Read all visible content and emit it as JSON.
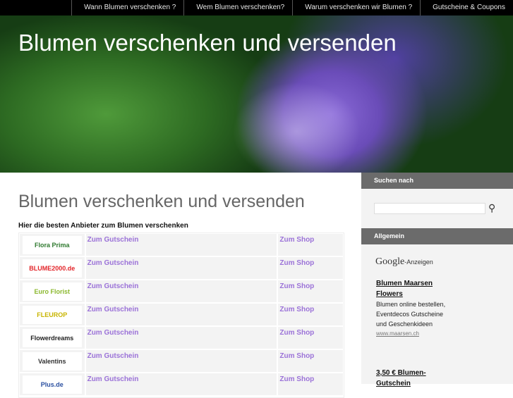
{
  "nav": [
    "Wann Blumen verschenken ?",
    "Wem Blumen verschenken?",
    "Warum verschenken wir Blumen ?",
    "Gutscheine & Coupons"
  ],
  "header": {
    "title": "Blumen verschenken und versenden"
  },
  "main": {
    "title": "Blumen verschenken und versenden",
    "subtitle": "Hier die besten Anbieter zum Blumen verschenken",
    "rows": [
      {
        "logo": "Flora Prima",
        "logo_color": "#2f7a2f",
        "voucher": "Zum Gutschein",
        "shop": "Zum Shop"
      },
      {
        "logo": "BLUME2000.de",
        "logo_color": "#e3262b",
        "voucher": "Zum Gutschein",
        "shop": "Zum Shop"
      },
      {
        "logo": "Euro Florist",
        "logo_color": "#8bb82e",
        "voucher": "Zum Gutschein",
        "shop": "Zum Shop"
      },
      {
        "logo": "FLEUROP",
        "logo_color": "#c8b400",
        "voucher": "Zum Gutschein",
        "shop": "Zum Shop"
      },
      {
        "logo": "Flowerdreams",
        "logo_color": "#222222",
        "voucher": "Zum Gutschein",
        "shop": "Zum Shop"
      },
      {
        "logo": "Valentins",
        "logo_color": "#333333",
        "voucher": "Zum Gutschein",
        "shop": "Zum Shop"
      },
      {
        "logo": "Plus.de",
        "logo_color": "#2a4fa0",
        "voucher": "Zum Gutschein",
        "shop": "Zum Shop"
      }
    ]
  },
  "sidebar": {
    "search_heading": "Suchen nach",
    "general_heading": "Allgemein",
    "google": "Google",
    "google_suffix": "-Anzeigen",
    "ads": [
      {
        "title": "Blumen Maarsen Flowers",
        "text": "Blumen online bestellen, Eventdecos Gutscheine und Geschenkideen",
        "url": "www.maarsen.ch"
      },
      {
        "title": "3,50 € Blumen-Gutschein"
      }
    ]
  }
}
